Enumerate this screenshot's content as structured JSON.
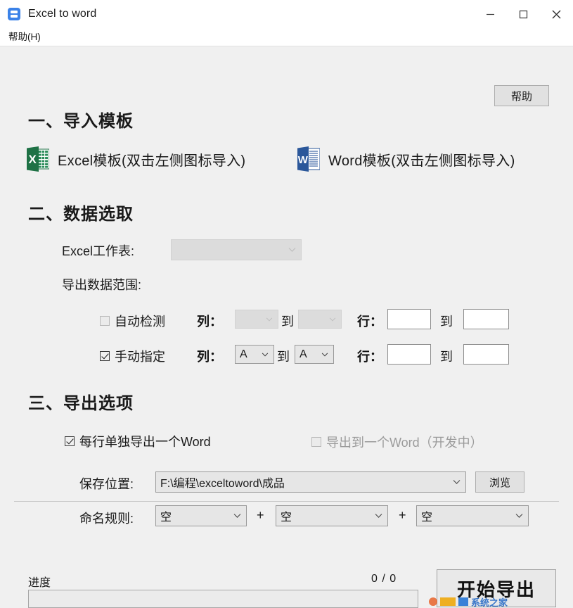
{
  "window": {
    "title": "Excel to word",
    "app_icon": "app-logo-icon",
    "controls": {
      "minimize": "minimize-icon",
      "maximize": "maximize-icon",
      "close": "close-icon"
    }
  },
  "menubar": {
    "items": [
      {
        "label": "帮助(H)"
      }
    ]
  },
  "section1": {
    "title": "一、导入模板",
    "help_button": "帮助",
    "excel_template": {
      "icon": "excel-file-icon",
      "label": "Excel模板(双击左侧图标导入)"
    },
    "word_template": {
      "icon": "word-file-icon",
      "label": "Word模板(双击左侧图标导入)"
    }
  },
  "section2": {
    "title": "二、数据选取",
    "worksheet_label": "Excel工作表:",
    "worksheet_value": "",
    "range_label": "导出数据范围:",
    "auto_row": {
      "checkbox_label": "自动检测",
      "checked": false,
      "col_label": "列：",
      "col_from": "",
      "col_to": "",
      "to_word": "到",
      "row_label": "行：",
      "row_from": "",
      "row_to": ""
    },
    "manual_row": {
      "checkbox_label": "手动指定",
      "checked": true,
      "col_label": "列：",
      "col_from": "A",
      "col_to": "A",
      "to_word": "到",
      "row_label": "行：",
      "row_from": "",
      "row_to": ""
    }
  },
  "section3": {
    "title": "三、导出选项",
    "per_row_option": {
      "label": "每行单独导出一个Word",
      "checked": true
    },
    "single_word_option": {
      "label": "导出到一个Word（开发中）",
      "checked": false
    },
    "save_label": "保存位置:",
    "save_path": "F:\\编程\\exceltoword\\成品",
    "browse_button": "浏览",
    "naming_label": "命名规则:",
    "naming_parts": [
      "空",
      "空",
      "空"
    ],
    "naming_joiner": "+"
  },
  "footer": {
    "progress_label": "进度",
    "progress_count": "0 / 0",
    "start_button": "开始导出",
    "watermark_text": "系统之家"
  }
}
